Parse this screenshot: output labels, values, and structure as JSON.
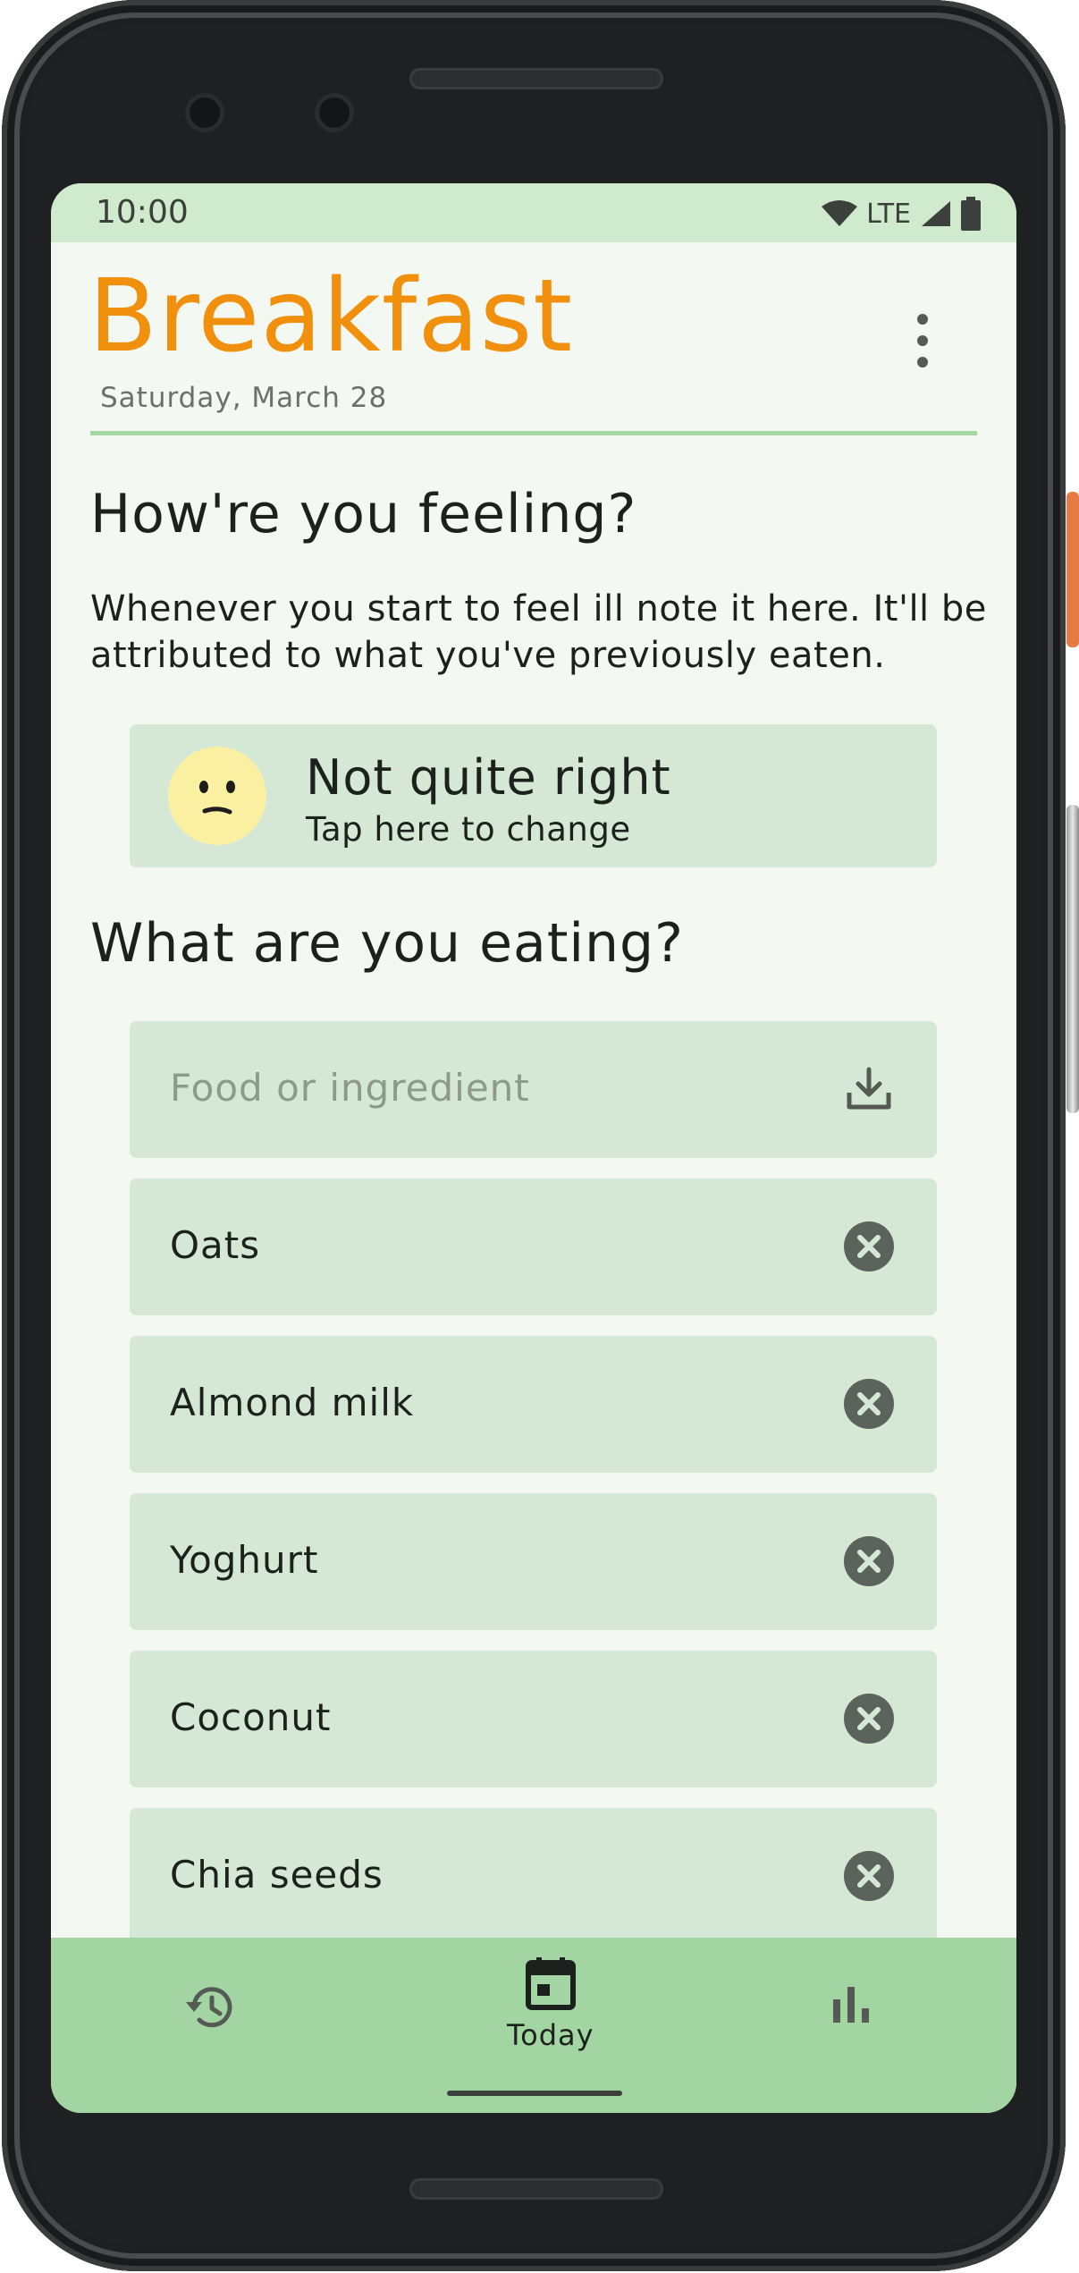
{
  "status_bar": {
    "time": "10:00",
    "network": "LTE"
  },
  "header": {
    "title": "Breakfast",
    "date": "Saturday, March 28"
  },
  "feeling": {
    "heading": "How're you feeling?",
    "description": "Whenever you start to feel ill note it here. It'll be attributed to what you've previously eaten.",
    "mood_title": "Not quite right",
    "mood_subtitle": "Tap here to change"
  },
  "eating": {
    "heading": "What are you eating?",
    "input_placeholder": "Food or ingredient",
    "items": [
      "Oats",
      "Almond milk",
      "Yoghurt",
      "Coconut",
      "Chia seeds"
    ]
  },
  "bottom_nav": {
    "today_label": "Today"
  },
  "colors": {
    "accent": "#f0900d",
    "card": "#d5e8d5",
    "nav": "#a3d5a3",
    "status": "#cfeacd"
  }
}
